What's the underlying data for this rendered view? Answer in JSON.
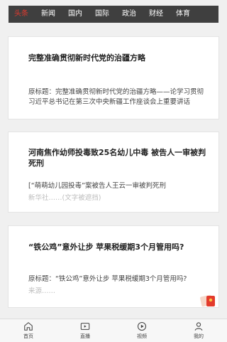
{
  "nav": {
    "tabs": [
      {
        "label": "头条",
        "active": true
      },
      {
        "label": "新闻"
      },
      {
        "label": "国内"
      },
      {
        "label": "国际"
      },
      {
        "label": "政治"
      },
      {
        "label": "财经"
      },
      {
        "label": "体育"
      }
    ]
  },
  "articles": [
    {
      "headline": "完整准确贯彻新时代党的治疆方略",
      "summary": "原标题：完整准确贯彻新时代党的治疆方略——论学习贯彻习近平总书记在第三次中央新疆工作座谈会上重要讲话"
    },
    {
      "headline": "河南焦作幼师投毒致25名幼儿中毒 被告人一审被判死刑",
      "summary": "[“萌萌幼儿园投毒”案被告人王云一审被判死刑",
      "faded": "新华社……(文字被遮挡)"
    },
    {
      "headline": "“铁公鸡”意外让步 苹果税缓期3个月管用吗?",
      "summary": "原标题：“铁公鸡”意外让步 苹果税缓期3个月管用吗?",
      "faded": "来源……"
    }
  ],
  "bottom": {
    "items": [
      {
        "label": "首页",
        "icon": "home-icon"
      },
      {
        "label": "直播",
        "icon": "live-icon"
      },
      {
        "label": "视频",
        "icon": "play-icon"
      },
      {
        "label": "我的",
        "icon": "user-icon"
      }
    ]
  },
  "colors": {
    "nav_bg": "#3f3f3f",
    "active_tab": "#e03a2f",
    "page_bg": "#f0f0f0"
  }
}
